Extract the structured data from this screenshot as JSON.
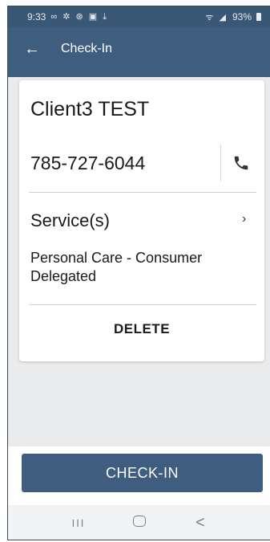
{
  "status_bar": {
    "time": "9:33",
    "left_icons": "∞ ✲ ⊛ ▣ ⤓",
    "right_icons": "ᯤ ◢",
    "battery": "93%"
  },
  "app_bar": {
    "back_icon": "back-arrow-icon",
    "title": "Check-In"
  },
  "client": {
    "name": "Client3 TEST",
    "phone": "785-727-6044",
    "phone_icon": "phone-icon"
  },
  "services": {
    "label": "Service(s)",
    "chevron": "›",
    "value": "Personal Care - Consumer Delegated"
  },
  "actions": {
    "delete_label": "DELETE",
    "checkin_label": "CHECK-IN"
  },
  "nav_bar": {
    "recents": "III",
    "back": "<"
  },
  "colors": {
    "primary": "#3f5e7f",
    "status_bar": "#3a5776",
    "background": "#e9ebed",
    "card": "#ffffff"
  }
}
